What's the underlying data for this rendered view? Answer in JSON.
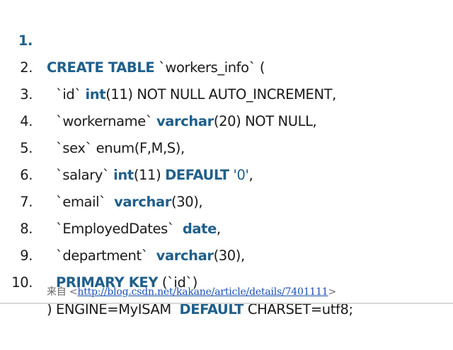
{
  "code": {
    "lines": [
      {
        "no": "1.",
        "parts": [
          "CREATE TABLE",
          " `workers_info` ("
        ]
      },
      {
        "no": "2.",
        "parts": [
          "`id` ",
          "int",
          "(11) NOT NULL AUTO_INCREMENT,"
        ]
      },
      {
        "no": "3.",
        "parts": [
          "`workername` ",
          "varchar",
          "(20) NOT NULL,"
        ]
      },
      {
        "no": "4.",
        "parts": [
          "`sex` enum(F,M,S),"
        ]
      },
      {
        "no": "5.",
        "parts": [
          "`salary` ",
          "int",
          "(11) ",
          "DEFAULT",
          " ",
          "'0'",
          ","
        ]
      },
      {
        "no": "6.",
        "parts": [
          "`email`  ",
          "varchar",
          "(30),"
        ]
      },
      {
        "no": "7.",
        "parts": [
          "`EmployedDates`  ",
          "date",
          ","
        ]
      },
      {
        "no": "8.",
        "parts": [
          "`department`  ",
          "varchar",
          "(30),"
        ]
      },
      {
        "no": "9.",
        "parts": [
          "PRIMARY KEY",
          " (`id`)"
        ]
      },
      {
        "no": "10.",
        "parts": [
          ") ENGINE=MyISAM  ",
          "DEFAULT",
          " CHARSET=utf8;"
        ]
      }
    ]
  },
  "source": {
    "prefix": "来自 <",
    "link": "http://blog.csdn.net/kakane/article/details/7401111",
    "suffix": ">"
  },
  "colors": {
    "keyword": "#1f5f8b",
    "text": "#1a1a1a",
    "link": "#1a4fb4"
  }
}
